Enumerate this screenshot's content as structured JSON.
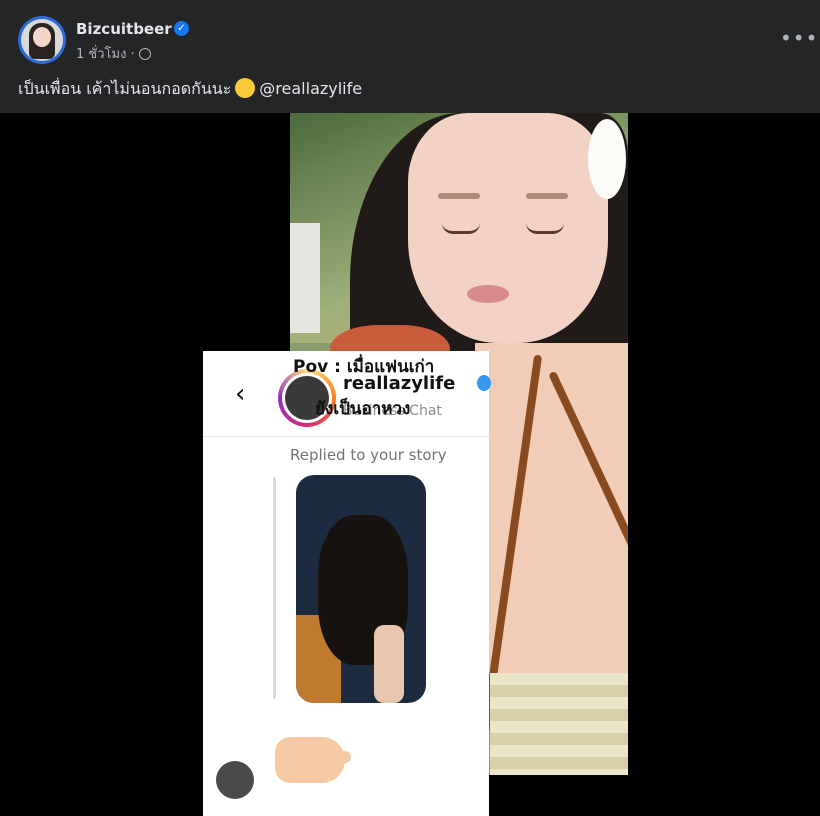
{
  "post": {
    "author": "Bizcuitbeer",
    "time": "1 ชั่วโมง ·",
    "caption": "เป็นเพื่อน เค้าไม่นอนกอดกันนะ",
    "mention": "@reallazylife",
    "more_label": "•••"
  },
  "icons": {
    "verified": "verified-badge-icon",
    "privacy": "globe-icon",
    "emoji": "winking-tongue-emoji-icon",
    "back": "chevron-left-icon"
  },
  "chat": {
    "back_glyph": "‹",
    "username": "reallazylife",
    "subtitle": "Business Chat",
    "overlay_line1": "Pov : เมื่อแฟนเก่า",
    "overlay_line2": "ยังเป็นอาหวง",
    "replied_label": "Replied to your story"
  },
  "colors": {
    "background": "#242526",
    "media_bg": "#000000",
    "accent": "#1877f2"
  }
}
